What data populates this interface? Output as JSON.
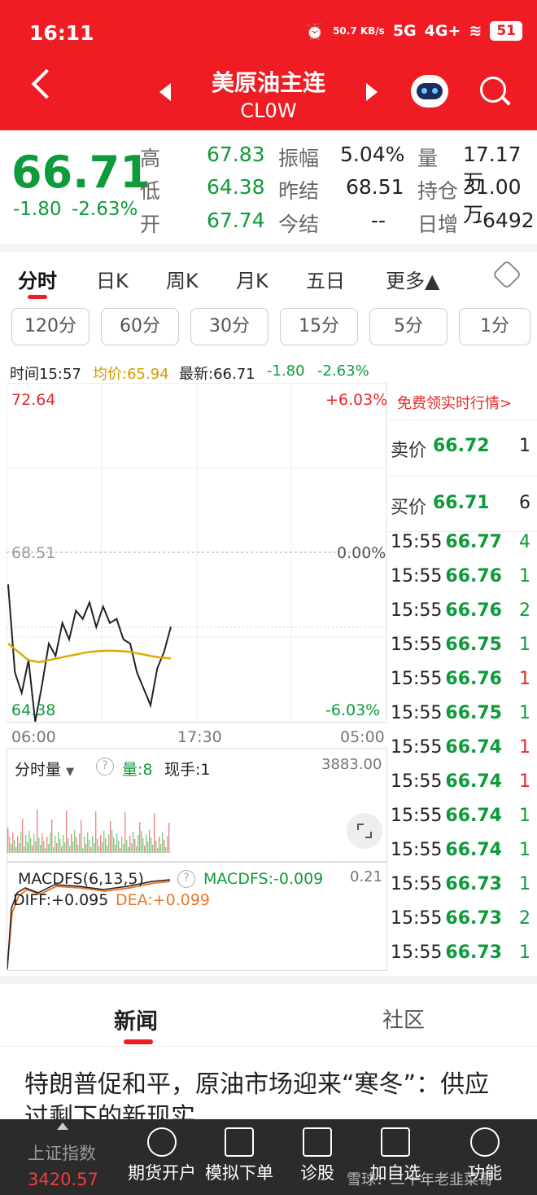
{
  "status": {
    "time": "16:11",
    "speed": "50.7 KB/s",
    "net1": "5G",
    "net2": "4G+",
    "battery": "51"
  },
  "header": {
    "title": "美原油主连",
    "subtitle": "CL0W"
  },
  "quote": {
    "price": "66.71",
    "change": "-1.80",
    "change_pct": "-2.63%",
    "high_label": "高",
    "high": "67.83",
    "low_label": "低",
    "low": "64.38",
    "open_label": "开",
    "open": "67.74",
    "amp_label": "振幅",
    "amp": "5.04%",
    "prev_settle_label": "昨结",
    "prev_settle": "68.51",
    "settle_label": "今结",
    "settle": "--",
    "vol_label": "量",
    "vol": "17.17万",
    "oi_label": "持仓",
    "oi": "31.00万",
    "daily_inc_label": "日增",
    "daily_inc": "-6492"
  },
  "tabs": [
    "分时",
    "日K",
    "周K",
    "月K",
    "五日",
    "更多▲"
  ],
  "periods": [
    "120分",
    "60分",
    "30分",
    "15分",
    "5分",
    "1分"
  ],
  "info_bar": {
    "time": "时间15:57",
    "avg": "均价:65.94",
    "latest": "最新:66.71",
    "chg": "-1.80",
    "pct": "-2.63%"
  },
  "chart_labels": {
    "top": "72.64",
    "top_pct": "+6.03%",
    "mid": "68.51",
    "mid_pct": "0.00%",
    "bottom": "64.38",
    "bottom_pct": "-6.03%",
    "x0": "06:00",
    "x1": "17:30",
    "x2": "05:00"
  },
  "promo": "免费领实时行情>",
  "orderbook": {
    "ask_label": "卖价",
    "ask": "66.72",
    "ask_vol": "1",
    "bid_label": "买价",
    "bid": "66.71",
    "bid_vol": "6"
  },
  "trades": [
    {
      "t": "15:55",
      "p": "66.77",
      "v": "4",
      "c": "green"
    },
    {
      "t": "15:55",
      "p": "66.76",
      "v": "1",
      "c": "green"
    },
    {
      "t": "15:55",
      "p": "66.76",
      "v": "2",
      "c": "green"
    },
    {
      "t": "15:55",
      "p": "66.75",
      "v": "1",
      "c": "green"
    },
    {
      "t": "15:55",
      "p": "66.76",
      "v": "1",
      "c": "red"
    },
    {
      "t": "15:55",
      "p": "66.75",
      "v": "1",
      "c": "green"
    },
    {
      "t": "15:55",
      "p": "66.74",
      "v": "1",
      "c": "red"
    },
    {
      "t": "15:55",
      "p": "66.74",
      "v": "1",
      "c": "red"
    },
    {
      "t": "15:55",
      "p": "66.74",
      "v": "1",
      "c": "green"
    },
    {
      "t": "15:55",
      "p": "66.74",
      "v": "1",
      "c": "green"
    },
    {
      "t": "15:55",
      "p": "66.73",
      "v": "1",
      "c": "green"
    },
    {
      "t": "15:55",
      "p": "66.73",
      "v": "2",
      "c": "green"
    },
    {
      "t": "15:55",
      "p": "66.73",
      "v": "1",
      "c": "green"
    }
  ],
  "volume_panel": {
    "label": "分时量",
    "vol": "量:8",
    "now": "现手:1",
    "max": "3883.00"
  },
  "macd_panel": {
    "label": "MACDFS(6,13,5)",
    "macdfs": "MACDFS:-0.009",
    "top": "0.21",
    "diff": "DIFF:+0.095",
    "dea": "DEA:+0.099"
  },
  "news_tabs": {
    "news": "新闻",
    "community": "社区"
  },
  "headline": "特朗普促和平，原油市场迎来“寒冬”：供应过剩下的新现实",
  "bottom_nav": {
    "index_label": "上证指数",
    "index_value": "3420.57",
    "items": [
      "期货开户",
      "模拟下单",
      "诊股",
      "加自选",
      "功能"
    ]
  },
  "watermark": "雪球：二十年老韭菜哥",
  "chart_data": {
    "type": "line",
    "title": "",
    "ylim": [
      64.38,
      72.64
    ],
    "x_ticks": [
      "06:00",
      "17:30",
      "05:00"
    ],
    "series": [
      {
        "values": [
          67.74,
          65.6,
          65.1,
          65.9,
          64.4,
          65.3,
          66.3,
          66.0,
          66.8,
          66.4,
          67.1,
          66.9,
          67.3,
          66.7,
          67.2,
          66.8,
          66.9,
          66.4,
          66.3,
          65.6,
          65.2,
          64.8,
          65.7,
          66.1,
          66.71
        ]
      },
      {
        "values": [
          66.3,
          66.1,
          65.9,
          65.85,
          65.9,
          65.95,
          66.0,
          66.05,
          66.1,
          66.12,
          66.13,
          66.12,
          66.1,
          66.05,
          66.0,
          65.96,
          65.94
        ]
      }
    ]
  }
}
